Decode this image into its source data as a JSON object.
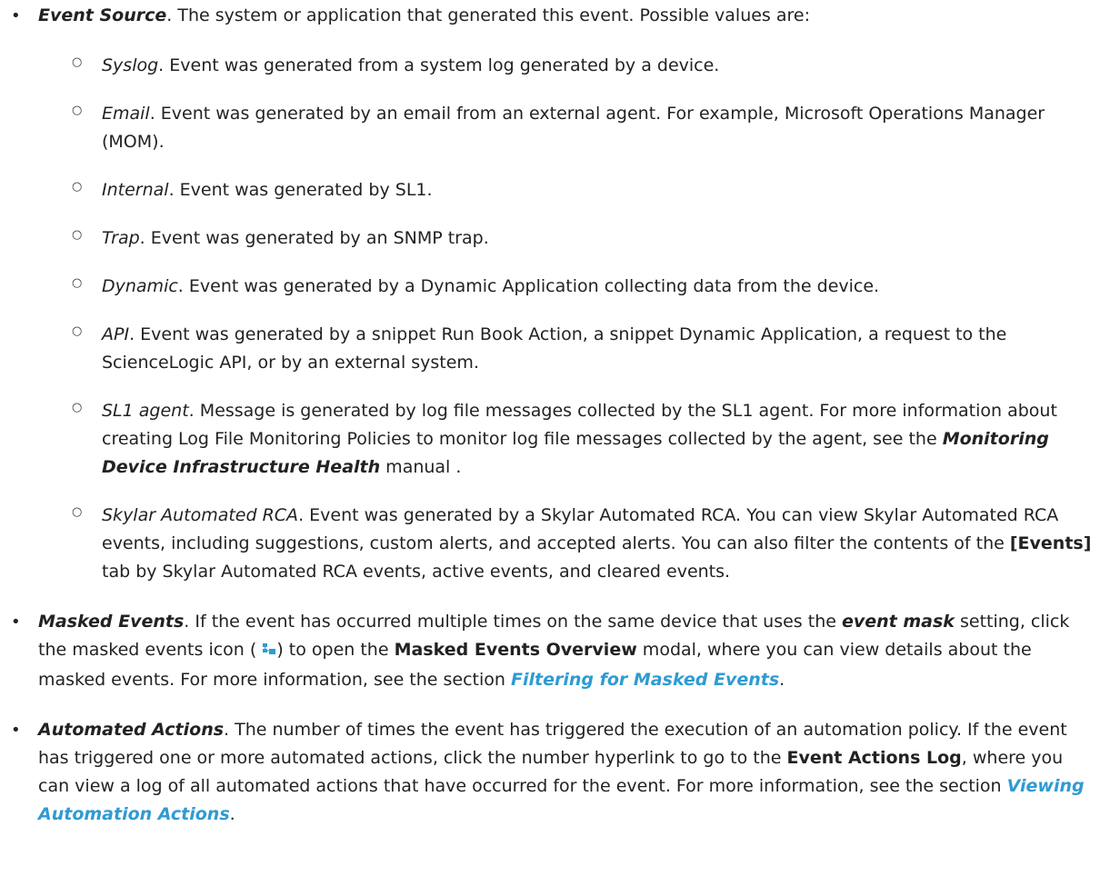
{
  "event_source": {
    "term": "Event Source",
    "desc": ". The system or application that generated this event. Possible values are:",
    "values": [
      {
        "term": "Syslog",
        "desc": ". Event was generated from a system log generated by a device."
      },
      {
        "term": "Email",
        "desc": ". Event was generated by an email from an external agent. For example, Microsoft Operations Manager (MOM)."
      },
      {
        "term": "Internal",
        "desc": ". Event was generated by SL1."
      },
      {
        "term": "Trap",
        "desc": ". Event was generated by an SNMP trap."
      },
      {
        "term": "Dynamic",
        "desc": ". Event was generated by a Dynamic Application collecting data from the device."
      },
      {
        "term": "API",
        "desc": ". Event was generated by a snippet Run Book Action, a snippet Dynamic Application, a request to the ScienceLogic API, or by an external system."
      }
    ],
    "agent": {
      "term": "SL1 agent",
      "desc_a": ". Message is generated by log file messages collected by the SL1 agent. For more information about creating Log File Monitoring Policies to monitor log file messages collected by the agent, see the ",
      "manual": "Monitoring Device Infrastructure Health",
      "desc_b": " manual ."
    },
    "skylar": {
      "term": "Skylar Automated RCA",
      "desc_a": ". Event was generated by a Skylar Automated RCA. You can view Skylar Automated RCA events, including suggestions, custom alerts, and accepted alerts. You can also filter the contents of the ",
      "tab": "[Events]",
      "desc_b": " tab by Skylar Automated RCA events, active events, and cleared events."
    }
  },
  "masked_events": {
    "term": "Masked Events",
    "t1": ". If the event has occurred multiple times on the same device that uses the ",
    "event_mask": "event mask",
    "t2": " setting, click the masked events icon ( ",
    "t3": ") to open the ",
    "modal": "Masked Events Overview",
    "t4": " modal, where you can view details about the masked events. For more information, see the section ",
    "link": "Filtering for Masked Events",
    "t5": ".",
    "icon": "masked-events-icon"
  },
  "automated_actions": {
    "term": "Automated Actions",
    "t1": ". The number of times the event has triggered the execution of an automation policy. If the event has triggered one or more automated actions, click the number hyperlink to go to the ",
    "log": "Event Actions Log",
    "t2": ", where you can view a log of all automated actions that have occurred for the event. For more information, see the section ",
    "link": "Viewing Automation Actions",
    "t3": "."
  },
  "colors": {
    "link": "#2f9bd2",
    "text": "#222222"
  }
}
